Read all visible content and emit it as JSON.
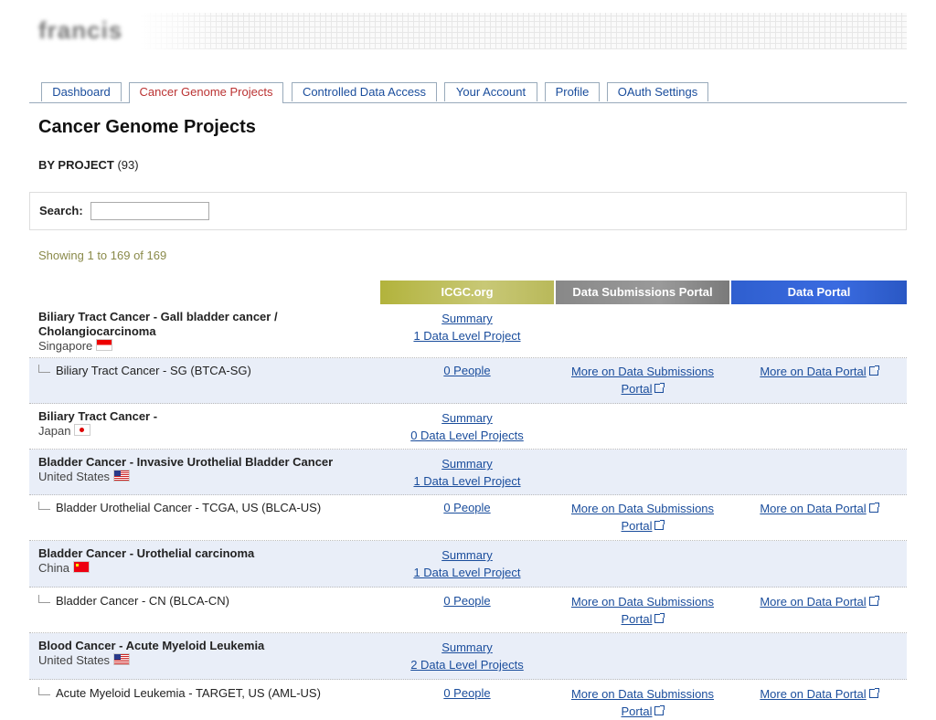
{
  "header": {
    "logo_text": "francis"
  },
  "tabs": [
    {
      "label": "Dashboard"
    },
    {
      "label": "Cancer Genome Projects",
      "active": true
    },
    {
      "label": "Controlled Data Access"
    },
    {
      "label": "Your Account"
    },
    {
      "label": "Profile"
    },
    {
      "label": "OAuth Settings"
    }
  ],
  "page": {
    "title": "Cancer Genome Projects",
    "by_project_label": "BY PROJECT",
    "by_project_count": "(93)",
    "search_label": "Search:",
    "search_value": "",
    "showing": "Showing 1 to 169 of 169"
  },
  "columns": {
    "icgc": "ICGC.org",
    "submissions": "Data Submissions Portal",
    "portal": "Data Portal"
  },
  "colors": {
    "icgc": "#b9b95a",
    "submissions": "#8f8f8f",
    "portal": "#3366d6",
    "link": "#1a4d9c",
    "active_tab": "#b33333"
  },
  "rows": [
    {
      "type": "project",
      "title": "Biliary Tract Cancer - Gall bladder cancer / Cholangiocarcinoma",
      "country": "Singapore",
      "flag": "sg-flag-icon",
      "summary": "Summary",
      "levels": "1 Data Level Project"
    },
    {
      "type": "sub",
      "name": "Biliary Tract Cancer - SG (BTCA-SG)",
      "people": "0 People",
      "submissions": "More on Data Submissions",
      "submissions2": "Portal",
      "portal": "More on Data Portal"
    },
    {
      "type": "project",
      "title": "Biliary Tract Cancer -",
      "country": "Japan",
      "flag": "jp-flag-icon",
      "summary": "Summary",
      "levels": "0 Data Level Projects"
    },
    {
      "type": "project",
      "title": "Bladder Cancer - Invasive Urothelial Bladder Cancer",
      "country": "United States",
      "flag": "us-flag-icon",
      "summary": "Summary",
      "levels": "1 Data Level Project"
    },
    {
      "type": "sub",
      "name": "Bladder Urothelial Cancer - TCGA, US (BLCA-US)",
      "people": "0 People",
      "submissions": "More on Data Submissions",
      "submissions2": "Portal",
      "portal": "More on Data Portal"
    },
    {
      "type": "project",
      "title": "Bladder Cancer - Urothelial carcinoma",
      "country": "China",
      "flag": "cn-flag-icon",
      "summary": "Summary",
      "levels": "1 Data Level Project"
    },
    {
      "type": "sub",
      "name": "Bladder Cancer - CN (BLCA-CN)",
      "people": "0 People",
      "submissions": "More on Data Submissions",
      "submissions2": "Portal",
      "portal": "More on Data Portal"
    },
    {
      "type": "project",
      "title": "Blood Cancer - Acute Myeloid Leukemia",
      "country": "United States",
      "flag": "us-flag-icon",
      "summary": "Summary",
      "levels": "2 Data Level Projects"
    },
    {
      "type": "sub",
      "name": "Acute Myeloid Leukemia - TARGET, US (AML-US)",
      "people": "0 People",
      "submissions": "More on Data Submissions",
      "submissions2": "Portal",
      "portal": "More on Data Portal"
    }
  ]
}
